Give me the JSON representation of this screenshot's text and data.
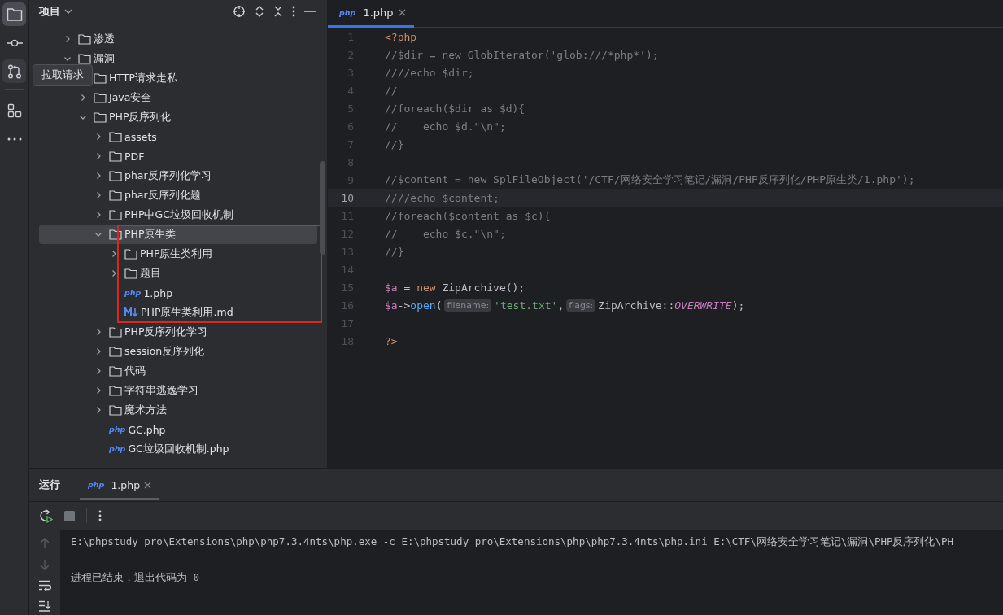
{
  "activity_bar": [
    {
      "kind": "project",
      "selected": true,
      "hovered": false
    },
    {
      "kind": "commit",
      "selected": false,
      "hovered": false
    },
    {
      "kind": "pull-requests",
      "selected": false,
      "hovered": true
    },
    {
      "kind": "structure",
      "selected": false,
      "hovered": false
    },
    {
      "kind": "more",
      "selected": false,
      "hovered": false
    }
  ],
  "tooltip": {
    "text": "拉取请求"
  },
  "project_panel": {
    "title": "项目"
  },
  "tree": {
    "items": [
      {
        "label": "渗透",
        "kind": "folder",
        "expanded": false,
        "selected": false,
        "outlined": false
      },
      {
        "label": "漏洞",
        "kind": "folder",
        "expanded": true,
        "selected": false,
        "outlined": false,
        "children": [
          {
            "label": "HTTP请求走私",
            "kind": "folder",
            "selected": false,
            "outlined": false
          },
          {
            "label": "Java安全",
            "kind": "folder",
            "expanded": false,
            "selected": false,
            "outlined": false
          },
          {
            "label": "PHP反序列化",
            "kind": "folder",
            "expanded": true,
            "selected": false,
            "outlined": false,
            "children": [
              {
                "label": "assets",
                "kind": "folder",
                "expanded": false,
                "selected": false,
                "outlined": false
              },
              {
                "label": "PDF",
                "kind": "folder",
                "expanded": false,
                "selected": false,
                "outlined": false
              },
              {
                "label": "phar反序列化学习",
                "kind": "folder",
                "expanded": false,
                "selected": false,
                "outlined": false
              },
              {
                "label": "phar反序列化题",
                "kind": "folder",
                "expanded": false,
                "selected": false,
                "outlined": false
              },
              {
                "label": "PHP中GC垃圾回收机制",
                "kind": "folder",
                "expanded": false,
                "selected": false,
                "outlined": false
              },
              {
                "label": "PHP原生类",
                "kind": "folder",
                "expanded": true,
                "selected": true,
                "outlined": true,
                "children": [
                  {
                    "label": "PHP原生类利用",
                    "kind": "folder",
                    "expanded": false,
                    "selected": false,
                    "outlined": false
                  },
                  {
                    "label": "题目",
                    "kind": "folder",
                    "expanded": false,
                    "selected": false,
                    "outlined": false
                  },
                  {
                    "label": "1.php",
                    "kind": "php",
                    "icon_label": "php",
                    "selected": false,
                    "outlined": false
                  },
                  {
                    "label": "PHP原生类利用.md",
                    "kind": "markdown",
                    "selected": false,
                    "outlined": false
                  }
                ]
              },
              {
                "label": "PHP反序列化学习",
                "kind": "folder",
                "expanded": false,
                "selected": false,
                "outlined": false
              },
              {
                "label": "session反序列化",
                "kind": "folder",
                "expanded": false,
                "selected": false,
                "outlined": false
              },
              {
                "label": "代码",
                "kind": "folder",
                "expanded": false,
                "selected": false,
                "outlined": false
              },
              {
                "label": "字符串逃逸学习",
                "kind": "folder",
                "expanded": false,
                "selected": false,
                "outlined": false
              },
              {
                "label": "魔术方法",
                "kind": "folder",
                "expanded": false,
                "selected": false,
                "outlined": false
              },
              {
                "label": "GC.php",
                "kind": "php",
                "icon_label": "php",
                "selected": false,
                "outlined": false
              },
              {
                "label": "GC垃圾回收机制.php",
                "kind": "php",
                "icon_label": "php",
                "selected": false,
                "outlined": false
              }
            ]
          }
        ]
      }
    ]
  },
  "editor": {
    "tabs": [
      {
        "icon_label": "php",
        "label": "1.php",
        "selected": true
      }
    ],
    "lines": [
      {
        "number": "1",
        "current": false,
        "tokens": [
          {
            "kind": "keyword",
            "text": "<?php"
          }
        ]
      },
      {
        "number": "2",
        "current": false,
        "tokens": [
          {
            "kind": "comment",
            "text": "//$dir = new GlobIterator('glob:///*php*');"
          }
        ]
      },
      {
        "number": "3",
        "current": false,
        "tokens": [
          {
            "kind": "comment",
            "text": "////echo $dir;"
          }
        ]
      },
      {
        "number": "4",
        "current": false,
        "tokens": [
          {
            "kind": "comment",
            "text": "//"
          }
        ]
      },
      {
        "number": "5",
        "current": false,
        "tokens": [
          {
            "kind": "comment",
            "text": "//foreach($dir as $d){"
          }
        ]
      },
      {
        "number": "6",
        "current": false,
        "tokens": [
          {
            "kind": "comment",
            "text": "//    echo $d.\"\\n\";"
          }
        ]
      },
      {
        "number": "7",
        "current": false,
        "tokens": [
          {
            "kind": "comment",
            "text": "//}"
          }
        ]
      },
      {
        "number": "8",
        "current": false
      },
      {
        "number": "9",
        "current": false,
        "tokens": [
          {
            "kind": "comment",
            "text": "//$content = new SplFileObject('/CTF/网络安全学习笔记/漏洞/PHP反序列化/PHP原生类/1.php');"
          }
        ]
      },
      {
        "number": "10",
        "current": true,
        "tokens": [
          {
            "kind": "comment",
            "text": "////echo $content;"
          }
        ]
      },
      {
        "number": "11",
        "current": false,
        "tokens": [
          {
            "kind": "comment",
            "text": "//foreach($content as $c){"
          }
        ]
      },
      {
        "number": "12",
        "current": false,
        "tokens": [
          {
            "kind": "comment",
            "text": "//    echo $c.\"\\n\";"
          }
        ]
      },
      {
        "number": "13",
        "current": false,
        "tokens": [
          {
            "kind": "comment",
            "text": "//}"
          }
        ]
      },
      {
        "number": "14",
        "current": false
      },
      {
        "number": "15",
        "current": false,
        "tokens": [
          {
            "kind": "variable",
            "text": "$a"
          },
          {
            "kind": "plain",
            "text": " = "
          },
          {
            "kind": "keyword",
            "text": "new"
          },
          {
            "kind": "plain",
            "text": " ZipArchive();"
          }
        ]
      },
      {
        "number": "16",
        "current": false,
        "tokens": [
          {
            "kind": "variable",
            "text": "$a"
          },
          {
            "kind": "plain",
            "text": "->"
          },
          {
            "kind": "function",
            "text": "open"
          },
          {
            "kind": "plain",
            "text": "("
          },
          {
            "kind": "hint",
            "text": "filename:"
          },
          {
            "kind": "string",
            "text": "'test.txt'"
          },
          {
            "kind": "plain",
            "text": ","
          },
          {
            "kind": "hint",
            "text": "flags:"
          },
          {
            "kind": "plain",
            "text": "ZipArchive::"
          },
          {
            "kind": "constant",
            "text": "OVERWRITE"
          },
          {
            "kind": "plain",
            "text": ");"
          }
        ]
      },
      {
        "number": "17",
        "current": false
      },
      {
        "number": "18",
        "current": false,
        "tokens": [
          {
            "kind": "keyword",
            "text": "?>"
          }
        ]
      }
    ]
  },
  "run_panel": {
    "title": "运行",
    "tabs": [
      {
        "icon_label": "php",
        "label": "1.php",
        "selected": true
      }
    ],
    "output": [
      "E:\\phpstudy_pro\\Extensions\\php\\php7.3.4nts\\php.exe -c E:\\phpstudy_pro\\Extensions\\php\\php7.3.4nts\\php.ini E:\\CTF\\网络安全学习笔记\\漏洞\\PHP反序列化\\PH",
      "进程已结束，退出代码为 0"
    ]
  }
}
